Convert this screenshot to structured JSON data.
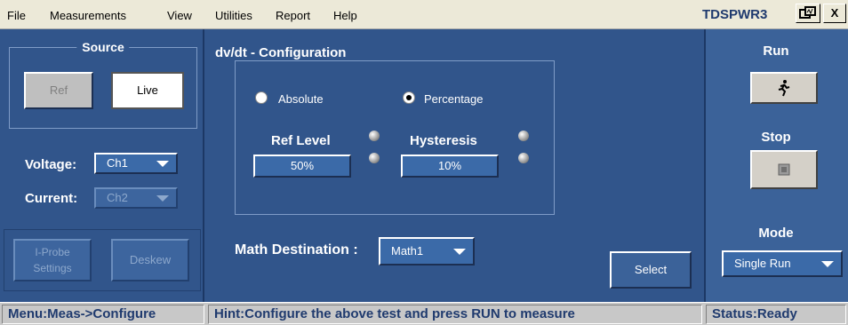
{
  "menu": {
    "file": "File",
    "measurements": "Measurements",
    "view": "View",
    "utilities": "Utilities",
    "report": "Report",
    "help": "Help"
  },
  "app_title": "TDSPWR3",
  "titlebar": {
    "close_label": "X"
  },
  "source": {
    "title": "Source",
    "ref_label": "Ref",
    "live_label": "Live"
  },
  "voltage": {
    "label": "Voltage:",
    "value": "Ch1"
  },
  "current": {
    "label": "Current:",
    "value": "Ch2"
  },
  "bottom_left": {
    "iprobe_line1": "I-Probe",
    "iprobe_line2": "Settings",
    "deskew_label": "Deskew"
  },
  "config": {
    "title": "dv/dt - Configuration",
    "absolute_label": "Absolute",
    "percentage_label": "Percentage",
    "selected_mode": "Percentage",
    "ref_level_label": "Ref Level",
    "ref_level_value": "50%",
    "hysteresis_label": "Hysteresis",
    "hysteresis_value": "10%"
  },
  "math": {
    "label": "Math Destination :",
    "value": "Math1"
  },
  "select_label": "Select",
  "right": {
    "run_label": "Run",
    "stop_label": "Stop",
    "mode_label": "Mode",
    "mode_value": "Single Run"
  },
  "status": {
    "menu": "Menu:Meas->Configure",
    "hint": "Hint:Configure the above test and press RUN to measure",
    "state": "Status:Ready"
  }
}
